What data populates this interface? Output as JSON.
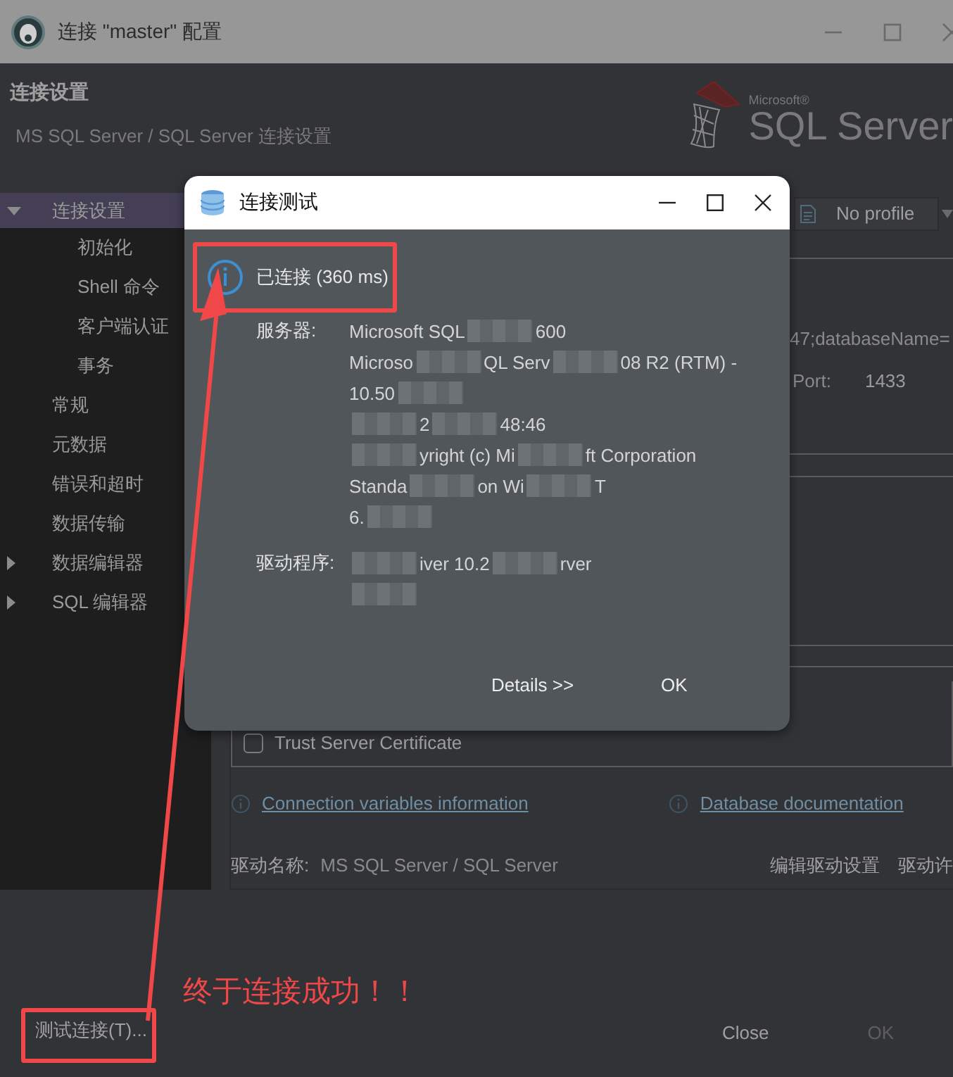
{
  "window": {
    "title": "连接 \"master\" 配置"
  },
  "header": {
    "title": "连接设置",
    "subtitle": "MS SQL Server / SQL Server 连接设置",
    "logo": {
      "brand": "Microsoft®",
      "product": "SQL Server"
    }
  },
  "sidebar": {
    "items": [
      {
        "label": "连接设置",
        "selected": true,
        "expanded": true,
        "children": [
          {
            "label": "初始化",
            "selected": false
          },
          {
            "label": "Shell 命令",
            "selected": false
          },
          {
            "label": "客户端认证",
            "selected": false
          },
          {
            "label": "事务",
            "selected": false
          }
        ]
      },
      {
        "label": "常规",
        "selected": false
      },
      {
        "label": "元数据",
        "selected": false
      },
      {
        "label": "错误和超时",
        "selected": false
      },
      {
        "label": "数据传输",
        "selected": false
      },
      {
        "label": "数据编辑器",
        "selected": false,
        "expanded": false
      },
      {
        "label": "SQL 编辑器",
        "selected": false,
        "expanded": false
      }
    ]
  },
  "settings": {
    "profile": "No profile",
    "url_fragment": "47;databaseName=",
    "port_label": "Port:",
    "port": "1433",
    "trust_certificate": {
      "label": "Trust Server Certificate",
      "checked": false
    },
    "links": [
      "Connection variables information",
      "Database documentation"
    ],
    "driver": {
      "label": "驱动名称:",
      "value": "MS SQL Server / SQL Server",
      "actions": [
        "编辑驱动设置",
        "驱动许"
      ]
    }
  },
  "footer": {
    "test_button": "测试连接(T)...",
    "buttons": [
      {
        "label": "Close",
        "disabled": false
      },
      {
        "label": "OK",
        "disabled": true
      }
    ]
  },
  "dialog": {
    "title": "连接测试",
    "status": "已连接 (360 ms)",
    "server_label": "服务器:",
    "server_lines": [
      [
        {
          "kind": "text",
          "text": "Microsoft SQL"
        },
        {
          "kind": "blur"
        },
        {
          "kind": "text",
          "text": "600"
        }
      ],
      [
        {
          "kind": "text",
          "text": "Microso"
        },
        {
          "kind": "blur"
        },
        {
          "kind": "text",
          "text": "QL Serv"
        },
        {
          "kind": "blur"
        },
        {
          "kind": "text",
          "text": "08 R2 (RTM) -"
        }
      ],
      [
        {
          "kind": "text",
          "text": "10.50"
        },
        {
          "kind": "blur"
        }
      ],
      [
        {
          "kind": "blur"
        },
        {
          "kind": "text",
          "text": "2"
        },
        {
          "kind": "blur"
        },
        {
          "kind": "text",
          "text": "48:46"
        }
      ],
      [
        {
          "kind": "blur"
        },
        {
          "kind": "text",
          "text": "yright (c) Mi"
        },
        {
          "kind": "blur"
        },
        {
          "kind": "text",
          "text": "ft Corporation"
        }
      ],
      [
        {
          "kind": "text",
          "text": "Standa"
        },
        {
          "kind": "blur"
        },
        {
          "kind": "text",
          "text": "on Wi"
        },
        {
          "kind": "blur"
        },
        {
          "kind": "text",
          "text": "T"
        }
      ],
      [
        {
          "kind": "text",
          "text": "6."
        },
        {
          "kind": "blur"
        }
      ]
    ],
    "driver_label": "驱动程序:",
    "driver_lines": [
      [
        {
          "kind": "blur"
        },
        {
          "kind": "text",
          "text": "iver 10.2"
        },
        {
          "kind": "blur"
        },
        {
          "kind": "text",
          "text": "rver"
        }
      ],
      [
        {
          "kind": "blur"
        }
      ]
    ],
    "buttons": [
      "Details >>",
      "OK"
    ]
  },
  "annotation": {
    "text": "终于连接成功！！"
  }
}
